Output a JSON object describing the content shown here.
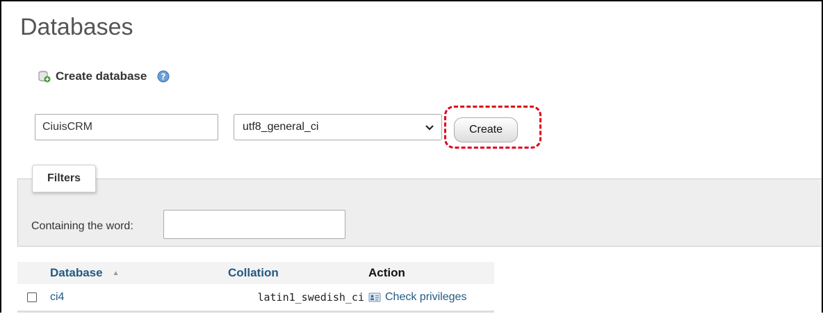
{
  "page": {
    "title": "Databases"
  },
  "create_database": {
    "heading": "Create database",
    "name_value": "CiuisCRM",
    "collation_value": "utf8_general_ci",
    "create_label": "Create"
  },
  "filters": {
    "tab_label": "Filters",
    "containing_label": "Containing the word:",
    "containing_value": ""
  },
  "table": {
    "headers": {
      "database": "Database",
      "collation": "Collation",
      "action": "Action"
    },
    "rows": [
      {
        "database": "ci4",
        "collation": "latin1_swedish_ci",
        "action": "Check privileges"
      }
    ]
  },
  "colors": {
    "link": "#235a81",
    "highlight": "#e0001b",
    "panel": "#eeeeee"
  },
  "icons": [
    "database-add-icon",
    "help-icon",
    "chevron-down-icon",
    "sort-ascending-icon",
    "check-privileges-icon"
  ]
}
